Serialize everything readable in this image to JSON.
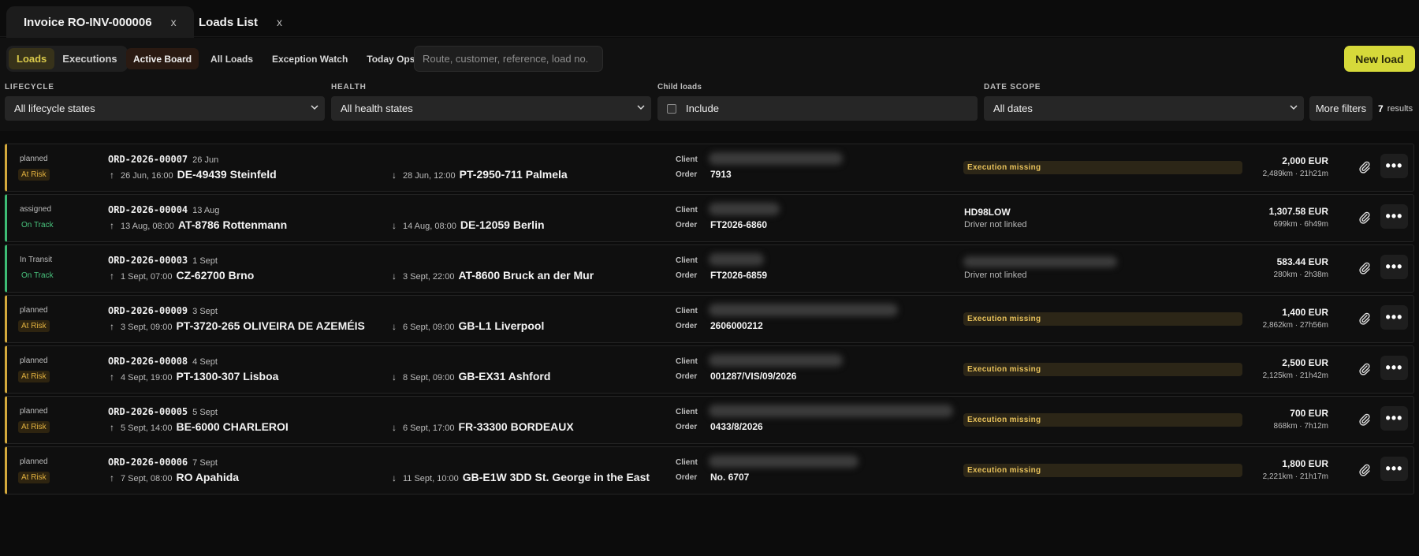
{
  "tabs": [
    {
      "label": "Invoice RO-INV-000006",
      "close": "x"
    },
    {
      "label": "Loads List",
      "close": "x"
    }
  ],
  "toolbar": {
    "segments": [
      "Loads",
      "Executions"
    ],
    "views": [
      "Active Board",
      "All Loads",
      "Exception Watch",
      "Today Ops"
    ],
    "search_placeholder": "Route, customer, reference, load no.",
    "new_load": "New load"
  },
  "filters": {
    "lifecycle_label": "LIFECYCLE",
    "lifecycle_value": "All lifecycle states",
    "health_label": "HEALTH",
    "health_value": "All health states",
    "child_label": "Child loads",
    "child_value": "Include",
    "date_label": "DATE SCOPE",
    "date_value": "All dates",
    "more_filters": "More filters",
    "result_count": "7",
    "result_text": "results"
  },
  "labels": {
    "client": "Client",
    "order": "Order"
  },
  "rows": [
    {
      "state": "planned",
      "health": "At Risk",
      "health_type": "risk",
      "id": "ORD-2026-00007",
      "date": "26 Jun",
      "from_time": "26 Jun, 16:00",
      "from": "DE-49439 Steinfeld",
      "to_time": "28 Jun, 12:00",
      "to": "PT-2950-711 Palmela",
      "order": "7913",
      "status": "Execution missing",
      "vehicle": "",
      "driver": "",
      "price": "2,000 EUR",
      "dist": "2,489km · 21h21m"
    },
    {
      "state": "assigned",
      "health": "On Track",
      "health_type": "ok",
      "id": "ORD-2026-00004",
      "date": "13 Aug",
      "from_time": "13 Aug, 08:00",
      "from": "AT-8786 Rottenmann",
      "to_time": "14 Aug, 08:00",
      "to": "DE-12059 Berlin",
      "order": "FT2026-6860",
      "status": "",
      "vehicle": "HD98LOW",
      "driver": "Driver not linked",
      "price": "1,307.58 EUR",
      "dist": "699km · 6h49m"
    },
    {
      "state": "In Transit",
      "health": "On Track",
      "health_type": "ok",
      "id": "ORD-2026-00003",
      "date": "1 Sept",
      "from_time": "1 Sept, 07:00",
      "from": "CZ-62700 Brno",
      "to_time": "3 Sept, 22:00",
      "to": "AT-8600 Bruck an der Mur",
      "order": "FT2026-6859",
      "status": "",
      "vehicle": "",
      "driver": "Driver not linked",
      "price": "583.44 EUR",
      "dist": "280km · 2h38m"
    },
    {
      "state": "planned",
      "health": "At Risk",
      "health_type": "risk",
      "id": "ORD-2026-00009",
      "date": "3 Sept",
      "from_time": "3 Sept, 09:00",
      "from": "PT-3720-265 OLIVEIRA DE AZEMÉIS",
      "to_time": "6 Sept, 09:00",
      "to": "GB-L1 Liverpool",
      "order": "2606000212",
      "status": "Execution missing",
      "vehicle": "",
      "driver": "",
      "price": "1,400 EUR",
      "dist": "2,862km · 27h56m"
    },
    {
      "state": "planned",
      "health": "At Risk",
      "health_type": "risk",
      "id": "ORD-2026-00008",
      "date": "4 Sept",
      "from_time": "4 Sept, 19:00",
      "from": "PT-1300-307 Lisboa",
      "to_time": "8 Sept, 09:00",
      "to": "GB-EX31 Ashford",
      "order": "001287/VIS/09/2026",
      "status": "Execution missing",
      "vehicle": "",
      "driver": "",
      "price": "2,500 EUR",
      "dist": "2,125km · 21h42m"
    },
    {
      "state": "planned",
      "health": "At Risk",
      "health_type": "risk",
      "id": "ORD-2026-00005",
      "date": "5 Sept",
      "from_time": "5 Sept, 14:00",
      "from": "BE-6000 CHARLEROI",
      "to_time": "6 Sept, 17:00",
      "to": "FR-33300 BORDEAUX",
      "order": "0433/8/2026",
      "status": "Execution missing",
      "vehicle": "",
      "driver": "",
      "price": "700 EUR",
      "dist": "868km · 7h12m"
    },
    {
      "state": "planned",
      "health": "At Risk",
      "health_type": "risk",
      "id": "ORD-2026-00006",
      "date": "7 Sept",
      "from_time": "7 Sept, 08:00",
      "from": "RO Apahida",
      "to_time": "11 Sept, 10:00",
      "to": "GB-E1W 3DD St. George in the East",
      "order": "No. 6707",
      "status": "Execution missing",
      "vehicle": "",
      "driver": "",
      "price": "1,800 EUR",
      "dist": "2,221km · 21h17m"
    }
  ],
  "colors": {
    "accent": "#d6d93a",
    "risk": "#d4a93c",
    "ok": "#3dbb74"
  }
}
